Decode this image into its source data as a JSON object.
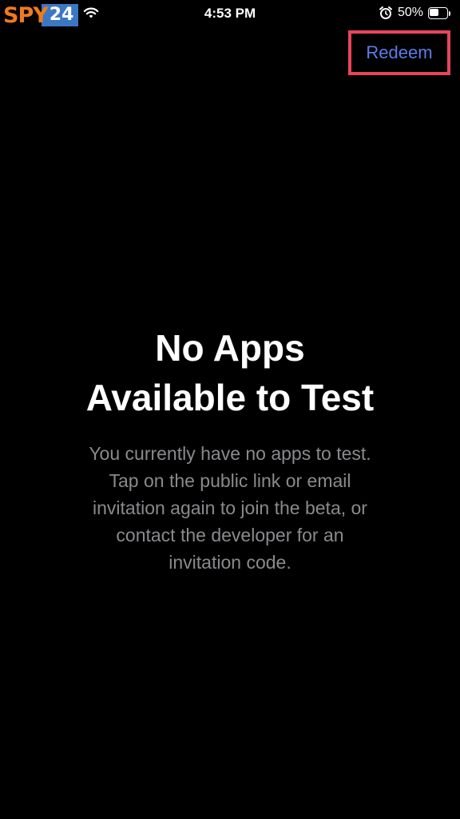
{
  "status_bar": {
    "logo": {
      "part1": "SPY",
      "part2": "24"
    },
    "time": "4:53 PM",
    "battery_percent": "50%",
    "battery_level": 0.5,
    "icons": [
      "wifi-icon",
      "alarm-icon",
      "battery-icon"
    ]
  },
  "nav": {
    "redeem_label": "Redeem"
  },
  "empty_state": {
    "title_lines": [
      "No Apps",
      "Available to Test"
    ],
    "description_lines": [
      "You currently have no apps to test.",
      "Tap on the public link or email",
      "invitation again to join the beta, or",
      "contact the developer for an",
      "invitation code."
    ]
  },
  "colors": {
    "background": "#000000",
    "accent": "#5b7de8",
    "highlight_box": "#e8455a",
    "secondary_text": "#8a8a8e",
    "logo_orange": "#f07a1c",
    "logo_blue": "#3b78c4"
  }
}
